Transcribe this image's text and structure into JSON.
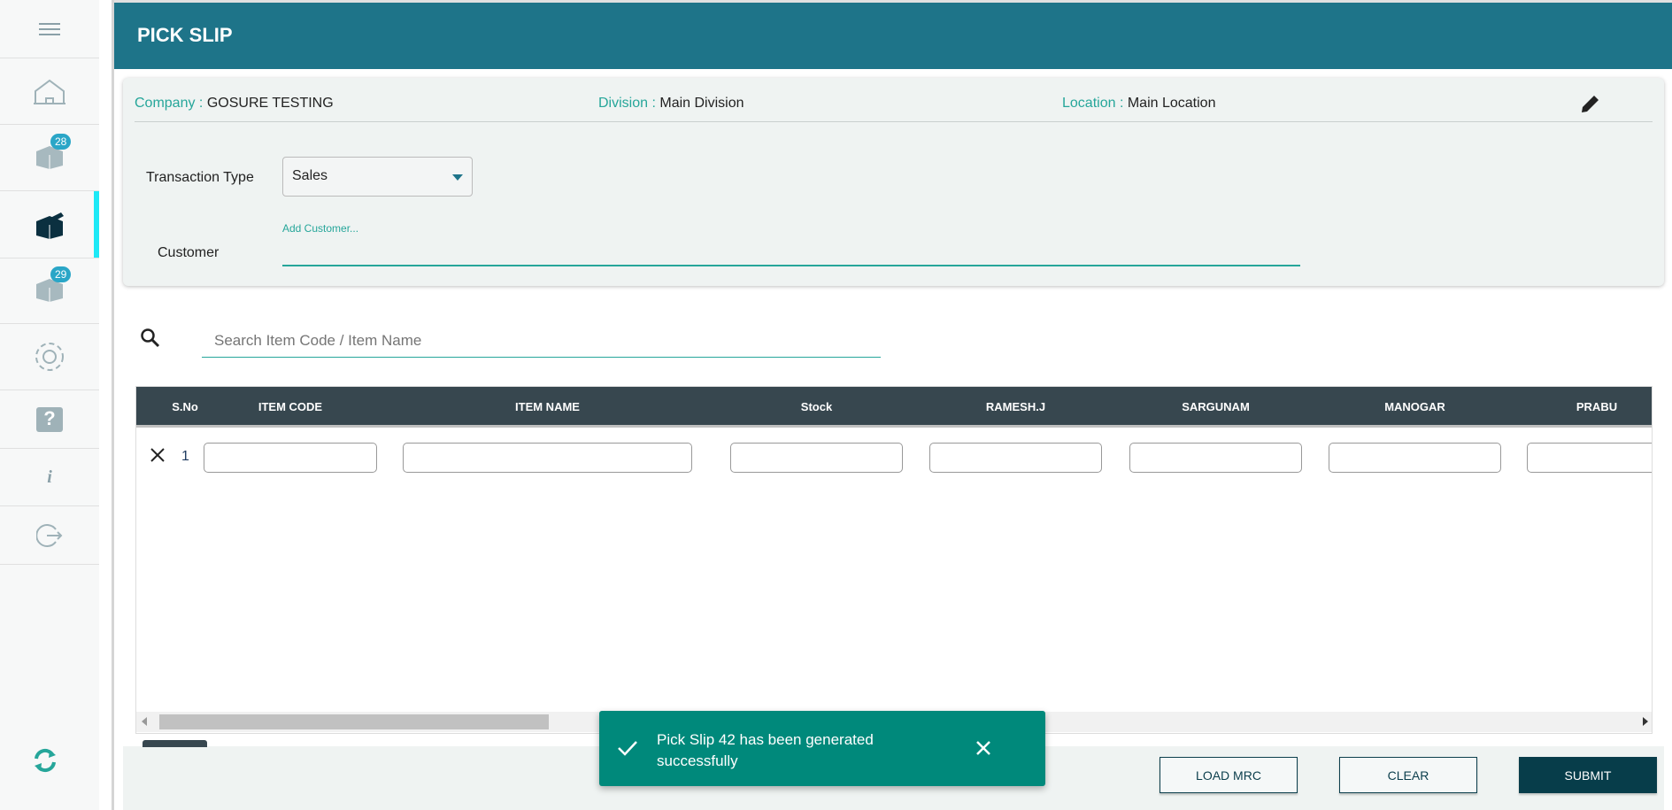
{
  "sidebar": {
    "items": [
      {
        "name": "menu",
        "icon": "hamburger-icon"
      },
      {
        "name": "home",
        "icon": "home-icon"
      },
      {
        "name": "inbound",
        "icon": "box-icon",
        "badge": "28"
      },
      {
        "name": "pick-slip",
        "icon": "open-box-icon",
        "active": true
      },
      {
        "name": "outbound",
        "icon": "box-icon",
        "badge": "29"
      },
      {
        "name": "settings",
        "icon": "gear-icon"
      },
      {
        "name": "help",
        "icon": "help-icon"
      },
      {
        "name": "info",
        "icon": "info-icon"
      },
      {
        "name": "logout",
        "icon": "logout-icon"
      }
    ],
    "sync_icon": "sync-icon"
  },
  "header": {
    "title": "PICK SLIP"
  },
  "info": {
    "company_label": "Company :",
    "company": "GOSURE TESTING",
    "division_label": "Division :",
    "division": "Main Division",
    "location_label": "Location :",
    "location": "Main Location"
  },
  "form": {
    "transaction_type_label": "Transaction Type",
    "transaction_type": "Sales",
    "customer_label": "Customer",
    "customer_placeholder": "Add Customer...",
    "customer_value": ""
  },
  "search": {
    "placeholder": "Search Item Code / Item Name"
  },
  "table": {
    "columns": [
      "S.No",
      "ITEM CODE",
      "ITEM NAME",
      "Stock",
      "RAMESH.J",
      "SARGUNAM",
      "MANOGAR",
      "PRABU"
    ],
    "rows": [
      {
        "sno": "1"
      }
    ]
  },
  "toast": {
    "message": "Pick Slip 42 has been generated successfully"
  },
  "buttons": {
    "load_mrc": "LOAD MRC",
    "clear": "CLEAR",
    "submit": "SUBMIT"
  },
  "colors": {
    "header": "#1e7489",
    "accent": "#26a69a",
    "toast": "#00897b",
    "submit": "#073d4a"
  }
}
